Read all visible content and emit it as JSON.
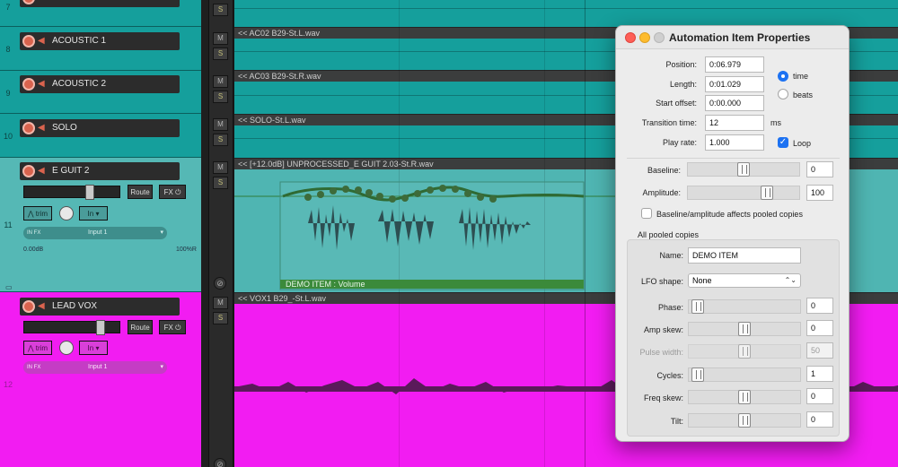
{
  "tracks": [
    {
      "number": "7",
      "name": ""
    },
    {
      "number": "8",
      "name": "ACOUSTIC 1",
      "item": "<< AC02 B29-St.L.wav"
    },
    {
      "number": "9",
      "name": "ACOUSTIC 2",
      "item": "<< AC03 B29-St.R.wav"
    },
    {
      "number": "10",
      "name": "SOLO",
      "item": "<< SOLO-St.L.wav"
    },
    {
      "number": "11",
      "name": "E GUIT 2",
      "item": "<< [+12.0dB] UNPROCESSED_E GUIT 2.03-St.R.wav",
      "route": "Route",
      "fx": "FX",
      "trim": "trim",
      "in": "In",
      "input": "Input 1",
      "vol_db": "0.00dB",
      "pan": "100%R",
      "in_fx": "IN FX"
    },
    {
      "number": "12",
      "name": "LEAD VOX",
      "item": "<< VOX1 B29_-St.L.wav",
      "route": "Route",
      "fx": "FX",
      "trim": "trim",
      "in": "In",
      "input": "Input 1",
      "in_fx": "IN FX"
    }
  ],
  "mute_label": "M",
  "solo_label": "S",
  "phase_symbol": "⊘",
  "automation_item_label": "DEMO ITEM : Volume",
  "colors": {
    "teal": "#159f9c",
    "magenta": "#f21cf2",
    "accent": "#1d72f2"
  },
  "dialog": {
    "title": "Automation Item Properties",
    "position_label": "Position:",
    "position": "0:06.979",
    "length_label": "Length:",
    "length": "0:01.029",
    "start_offset_label": "Start offset:",
    "start_offset": "0:00.000",
    "transition_label": "Transition time:",
    "transition": "12",
    "transition_unit": "ms",
    "play_rate_label": "Play rate:",
    "play_rate": "1.000",
    "time_label": "time",
    "beats_label": "beats",
    "time_selected": true,
    "loop_label": "Loop",
    "loop_checked": true,
    "baseline_label": "Baseline:",
    "baseline": "0",
    "amplitude_label": "Amplitude:",
    "amplitude": "100",
    "pooled_label": "Baseline/amplitude affects pooled copies",
    "pooled_checked": false,
    "group_label": "All pooled copies",
    "name_label": "Name:",
    "name": "DEMO ITEM",
    "lfo_label": "LFO shape:",
    "lfo": "None",
    "phase_label": "Phase:",
    "phase": "0",
    "amp_skew_label": "Amp skew:",
    "amp_skew": "0",
    "pulse_width_label": "Pulse width:",
    "pulse_width": "50",
    "cycles_label": "Cycles:",
    "cycles": "1",
    "freq_skew_label": "Freq skew:",
    "freq_skew": "0",
    "tilt_label": "Tilt:",
    "tilt": "0"
  }
}
